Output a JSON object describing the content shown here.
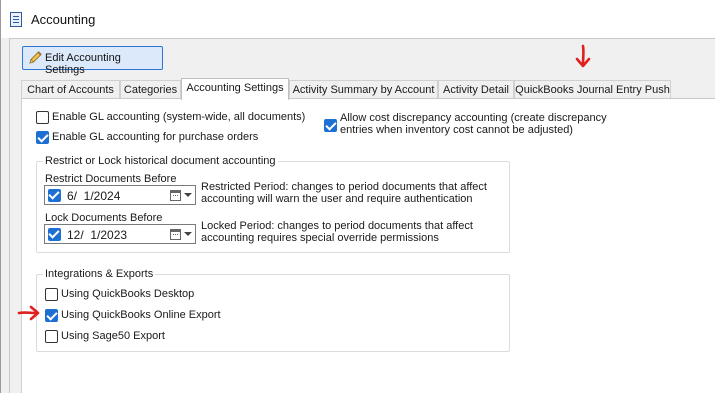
{
  "window": {
    "title": "Accounting"
  },
  "toolbar": {
    "edit_label": "Edit Accounting Settings"
  },
  "tabs": [
    {
      "label": "Chart of Accounts"
    },
    {
      "label": "Categories"
    },
    {
      "label": "Accounting Settings"
    },
    {
      "label": "Activity Summary by Account"
    },
    {
      "label": "Activity Detail"
    },
    {
      "label": "QuickBooks Journal Entry Push"
    }
  ],
  "gl": {
    "enable_gl": {
      "label": "Enable GL accounting (system-wide, all documents)",
      "checked": false
    },
    "enable_gl_po": {
      "label": "Enable GL accounting for purchase orders",
      "checked": true
    },
    "cost_discrepancy": {
      "label": "Allow cost discrepancy accounting (create discrepancy entries when inventory cost cannot be adjusted)",
      "checked": true
    }
  },
  "restrict": {
    "group_title": "Restrict or Lock historical document accounting",
    "restrict_label": "Restrict Documents Before",
    "restrict_date": "6/  1/2024",
    "restrict_desc": "Restricted Period: changes to period documents that affect accounting will warn the user and require authentication",
    "lock_label": "Lock Documents Before",
    "lock_date": "12/  1/2023",
    "lock_desc": "Locked Period: changes to period documents that affect accounting requires special override permissions"
  },
  "integrations": {
    "group_title": "Integrations & Exports",
    "qb_desktop": {
      "label": "Using QuickBooks Desktop",
      "checked": false
    },
    "qb_online": {
      "label": "Using QuickBooks Online Export",
      "checked": true
    },
    "sage50": {
      "label": "Using Sage50 Export",
      "checked": false
    }
  },
  "colors": {
    "accent": "#1d6fd1",
    "annotation_arrow": "#e02020",
    "button_bg": "#dbe9fa"
  },
  "icons": {
    "window": "document-list-icon",
    "edit": "pencil-icon"
  }
}
